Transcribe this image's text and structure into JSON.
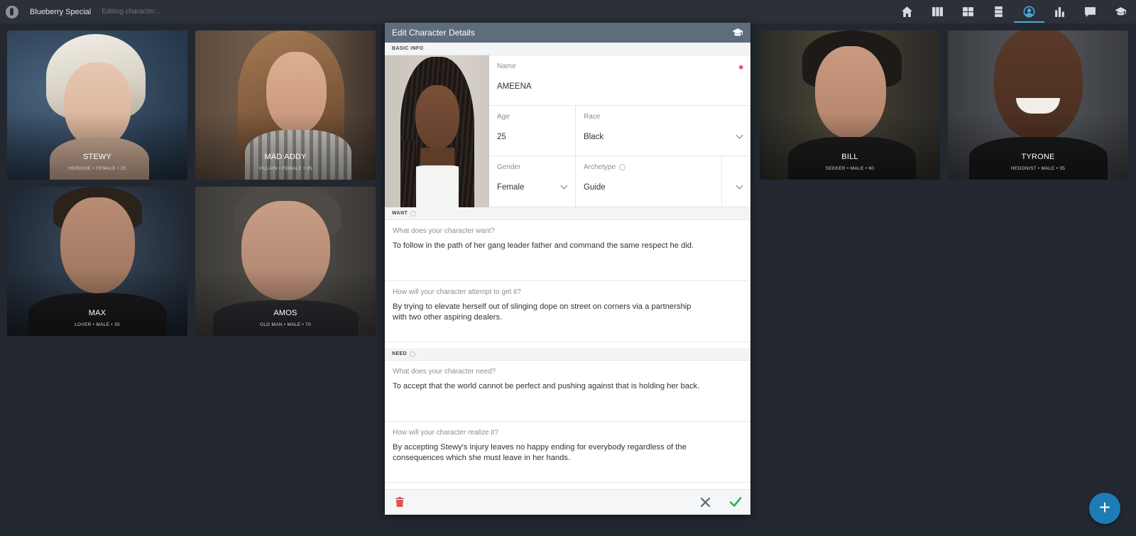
{
  "app": {
    "title": "Blueberry Special",
    "subtitle": "Editing character..."
  },
  "nav": {
    "items": [
      {
        "icon": "home-icon"
      },
      {
        "icon": "columns-icon"
      },
      {
        "icon": "grid-icon"
      },
      {
        "icon": "rows-icon"
      },
      {
        "icon": "user-icon",
        "active": true
      },
      {
        "icon": "bar-chart-icon"
      },
      {
        "icon": "chat-icon"
      },
      {
        "icon": "graduation-cap-icon"
      }
    ]
  },
  "cards": [
    {
      "name": "STEWY",
      "meta": "HEROINE • FEMALE • 25"
    },
    {
      "name": "MAD ADDY",
      "meta": "VILLAIN • FEMALE • 35"
    },
    {
      "name": "BILL",
      "meta": "SEEKER • MALE • 60"
    },
    {
      "name": "TYRONE",
      "meta": "HEDONIST • MALE • 35"
    },
    {
      "name": "MAX",
      "meta": "LOVER • MALE • 35"
    },
    {
      "name": "AMOS",
      "meta": "OLD MAN • MALE • 70"
    }
  ],
  "modal": {
    "title": "Edit Character Details",
    "basic_info_label": "BASIC INFO",
    "name": {
      "label": "Name",
      "value": "AMEENA",
      "required_mark": "*"
    },
    "age": {
      "label": "Age",
      "value": "25"
    },
    "race": {
      "label": "Race",
      "value": "Black"
    },
    "gender": {
      "label": "Gender",
      "value": "Female"
    },
    "archetype": {
      "label": "Archetype",
      "value": "Guide"
    },
    "want_label": "WANT",
    "want_q1": {
      "label": "What does your character want?",
      "value": "To follow in the path of her gang leader father and command the same respect he did."
    },
    "want_q2": {
      "label": "How will your character attempt to get it?",
      "value": "By trying to elevate herself out of slinging dope on street on corners via a partnership with two other aspiring dealers."
    },
    "need_label": "NEED",
    "need_q1": {
      "label": "What does your character need?",
      "value": "To accept that the world cannot be perfect and pushing against that is holding her back."
    },
    "need_q2": {
      "label": "How will your character realize it?",
      "value": "By accepting Stewy's injury leaves no happy ending for everybody regardless of the consequences which she must leave in her hands."
    }
  },
  "fab": {
    "label": "+"
  },
  "colors": {
    "background": "#232830",
    "topbar": "#2b3039",
    "modal_header": "#5e6c7c",
    "accent": "#4aa8d8",
    "fab": "#1d7cb4",
    "required": "#d9343f",
    "delete": "#d9534f",
    "confirm": "#2fae55"
  }
}
